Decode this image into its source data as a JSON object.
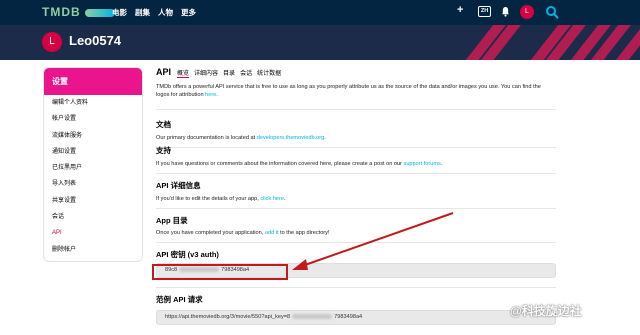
{
  "nav": {
    "logo": "TMDB",
    "menu": [
      "电影",
      "剧集",
      "人物",
      "更多"
    ],
    "plus": "+",
    "lang": "ZH",
    "avatar_letter": "L"
  },
  "profile": {
    "avatar_letter": "L",
    "username": "Leo0574"
  },
  "sidebar": {
    "title": "设置",
    "items": [
      {
        "label": "编辑个人资料"
      },
      {
        "label": "帐户设置"
      },
      {
        "label": "流媒体服务"
      },
      {
        "label": "通知设置"
      },
      {
        "label": "已拉黑用户"
      },
      {
        "label": "导入列表"
      },
      {
        "label": "共享设置"
      },
      {
        "label": "会话"
      },
      {
        "label": "API"
      },
      {
        "label": "删除帐户"
      }
    ]
  },
  "main": {
    "title": "API",
    "tabs": [
      "概览",
      "详细内容",
      "目录",
      "会话",
      "统计数据"
    ],
    "intro_a": "TMDb offers a powerful API service that is free to use as long as you properly attribute us as the source of the data and/or images you use. You can find the logos for attribution ",
    "intro_link": "here",
    "intro_b": ".",
    "docs": {
      "heading": "文档",
      "text": "Our primary documentation is located at ",
      "link": "developers.themoviedb.org",
      "tail": "."
    },
    "support": {
      "heading": "支持",
      "text": "If you have questions or comments about the information covered here, please create a post on our ",
      "link": "support forums",
      "tail": "."
    },
    "details": {
      "heading": "API 详细信息",
      "text": "If you'd like to edit the details of your app, ",
      "link": "click here",
      "tail": "."
    },
    "appdir": {
      "heading": "App 目录",
      "text": "Once you have completed your application, ",
      "link": "add it",
      "tail": " to the app directory!"
    },
    "key": {
      "heading": "API 密钥 (v3 auth)",
      "prefix": "89c8",
      "suffix": "7983498a4"
    },
    "request": {
      "heading": "范例 API 请求",
      "prefix": "https://api.themoviedb.org/3/movie/550?api_key=8",
      "suffix": "7983498a4"
    }
  },
  "watermark": "@科技旋边社",
  "colors": {
    "nav_bg": "#032541",
    "accent": "#ea148c",
    "link": "#d40242",
    "highlight": "#c21a1a"
  }
}
